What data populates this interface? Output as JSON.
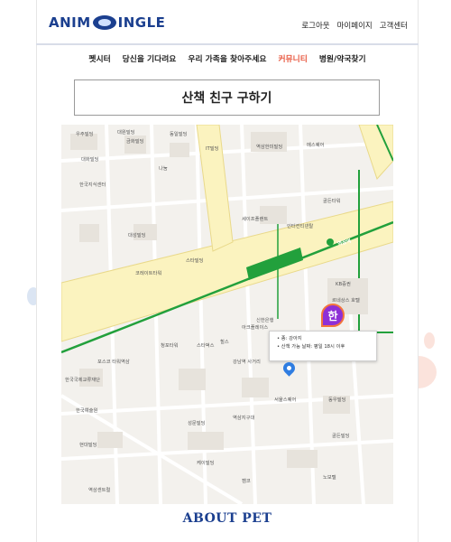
{
  "header": {
    "logo_text_left": "ANIM",
    "logo_text_right": "INGLE",
    "util_links": [
      "로그아웃",
      "마이페이지",
      "고객센터"
    ]
  },
  "nav": {
    "items": [
      "펫시터",
      "당신을 기다려요",
      "우리 가족을 찾아주세요",
      "커뮤니티",
      "병원/약국찾기"
    ],
    "active_index": 3
  },
  "page": {
    "title": "산책 친구 구하기"
  },
  "map": {
    "labels": [
      "우주빌딩",
      "대원빌딩",
      "금화빌딩",
      "동일빌딩",
      "대화빌딩",
      "나눔",
      "IT빌딩",
      "역삼한미빌딩",
      "메스퀘어",
      "한국지식센터",
      "세이프플랜트",
      "인터컨티넨탈",
      "골든타워",
      "대성빌딩",
      "코레이트타워",
      "스타빌딩",
      "아크플레이스",
      "신한은행",
      "청포타워",
      "스타벅스",
      "힐스",
      "포스코 타워역삼",
      "한국국제교류재단",
      "강남역 사거리",
      "KB증권",
      "르네상스 호텔",
      "서울스퀘어",
      "동우빌딩",
      "한국예술원",
      "골든빌딩",
      "성문빌딩",
      "역삼지구대",
      "현대빌딩",
      "케이빌딩",
      "노보텔",
      "캠코",
      "역삼센트럴"
    ],
    "station_label": "역삼역",
    "marker_char": "한",
    "popup_lines": [
      "• 종: 강아지",
      "• 산책 가능 날짜: 평일 18시 이후"
    ]
  },
  "footer": {
    "title": "ABOUT PET"
  },
  "colors": {
    "brand": "#1b3f8f",
    "accent": "#e8573f",
    "line2": "#22a03c",
    "road": "#fbf3bf",
    "marker": "#8e2fd6"
  }
}
